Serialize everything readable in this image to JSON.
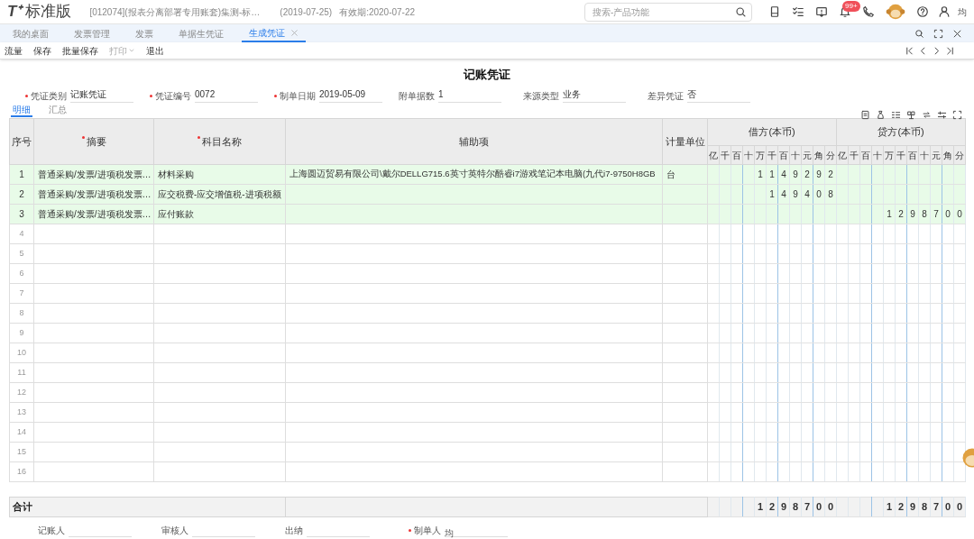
{
  "app": {
    "logo": "T⁺",
    "edition": "标准版",
    "account": "[012074](报表分离部署专用账套)集测-标…",
    "date": "(2019-07-25)",
    "expiry": "有效期:2020-07-22",
    "search_placeholder": "搜索-产品功能",
    "badge": "99+",
    "user": "均"
  },
  "tabs": [
    {
      "label": "我的桌面",
      "selected": false,
      "closable": false
    },
    {
      "label": "发票管理",
      "selected": false,
      "closable": false
    },
    {
      "label": "发票",
      "selected": false,
      "closable": false
    },
    {
      "label": "单据生凭证",
      "selected": false,
      "closable": false
    },
    {
      "label": "生成凭证",
      "selected": true,
      "closable": true
    }
  ],
  "toolbar": [
    {
      "label": "流量",
      "disabled": false,
      "dropdown": false
    },
    {
      "label": "保存",
      "disabled": false,
      "dropdown": false
    },
    {
      "label": "批量保存",
      "disabled": false,
      "dropdown": false
    },
    {
      "label": "打印",
      "disabled": true,
      "dropdown": true
    },
    {
      "label": "退出",
      "disabled": false,
      "dropdown": false
    }
  ],
  "title": "记账凭证",
  "fields": [
    {
      "label": "凭证类别",
      "value": "记账凭证",
      "required": true
    },
    {
      "label": "凭证编号",
      "value": "0072",
      "required": true
    },
    {
      "label": "制单日期",
      "value": "2019-05-09",
      "required": true
    },
    {
      "label": "附单据数",
      "value": "1",
      "required": false
    },
    {
      "label": "来源类型",
      "value": "业务",
      "required": false
    },
    {
      "label": "差异凭证",
      "value": "否",
      "required": false
    }
  ],
  "subtabs": [
    {
      "label": "明细",
      "selected": true
    },
    {
      "label": "汇总",
      "selected": false
    }
  ],
  "table": {
    "columns": [
      {
        "label": "序号",
        "required": false
      },
      {
        "label": "摘要",
        "required": true
      },
      {
        "label": "科目名称",
        "required": true
      },
      {
        "label": "辅助项",
        "required": false
      },
      {
        "label": "计量单位",
        "required": false
      }
    ],
    "debit_label": "借方(本币)",
    "credit_label": "贷方(本币)",
    "debit_units": [
      "亿",
      "千",
      "百",
      "十",
      "万",
      "千",
      "百",
      "十",
      "元",
      "角",
      "分"
    ],
    "credit_units": [
      "亿",
      "千",
      "百",
      "十",
      "万",
      "千",
      "百",
      "十",
      "元",
      "角",
      "分"
    ],
    "rows": [
      {
        "seq": "1",
        "summary": "普通采购/发票/进项税发票…",
        "account": "材料采购",
        "aux": "上海圆迈贸易有限公司\\戴尔DELLG715.6英寸英特尔酷睿i7游戏笔记本电脑(九代i7-9750H8GB",
        "unit": "台",
        "debit": [
          "1",
          "1",
          "4",
          "9",
          "2",
          "9",
          "2"
        ]
      },
      {
        "seq": "2",
        "summary": "普通采购/发票/进项税发票…",
        "account": "应交税费-应交增值税-进项税额",
        "debit": [
          "1",
          "4",
          "9",
          "4",
          "0",
          "8"
        ]
      },
      {
        "seq": "3",
        "summary": "普通采购/发票/进项税发票…",
        "account": "应付账款",
        "credit": [
          "1",
          "2",
          "9",
          "8",
          "7",
          "0",
          "0"
        ]
      },
      {
        "seq": "4"
      },
      {
        "seq": "5"
      },
      {
        "seq": "6"
      },
      {
        "seq": "7"
      },
      {
        "seq": "8"
      },
      {
        "seq": "9"
      },
      {
        "seq": "10"
      },
      {
        "seq": "11"
      },
      {
        "seq": "12"
      },
      {
        "seq": "13"
      },
      {
        "seq": "14"
      },
      {
        "seq": "15"
      },
      {
        "seq": "16"
      }
    ],
    "total": {
      "label": "合计",
      "debit": [
        "1",
        "2",
        "9",
        "8",
        "7",
        "0",
        "0"
      ],
      "credit": [
        "1",
        "2",
        "9",
        "8",
        "7",
        "0",
        "0"
      ]
    }
  },
  "signatures": [
    {
      "label": "记账人",
      "required": false
    },
    {
      "label": "审核人",
      "required": false
    },
    {
      "label": "出纳",
      "required": false
    },
    {
      "label": "制单人",
      "required": true,
      "value": "均"
    }
  ]
}
